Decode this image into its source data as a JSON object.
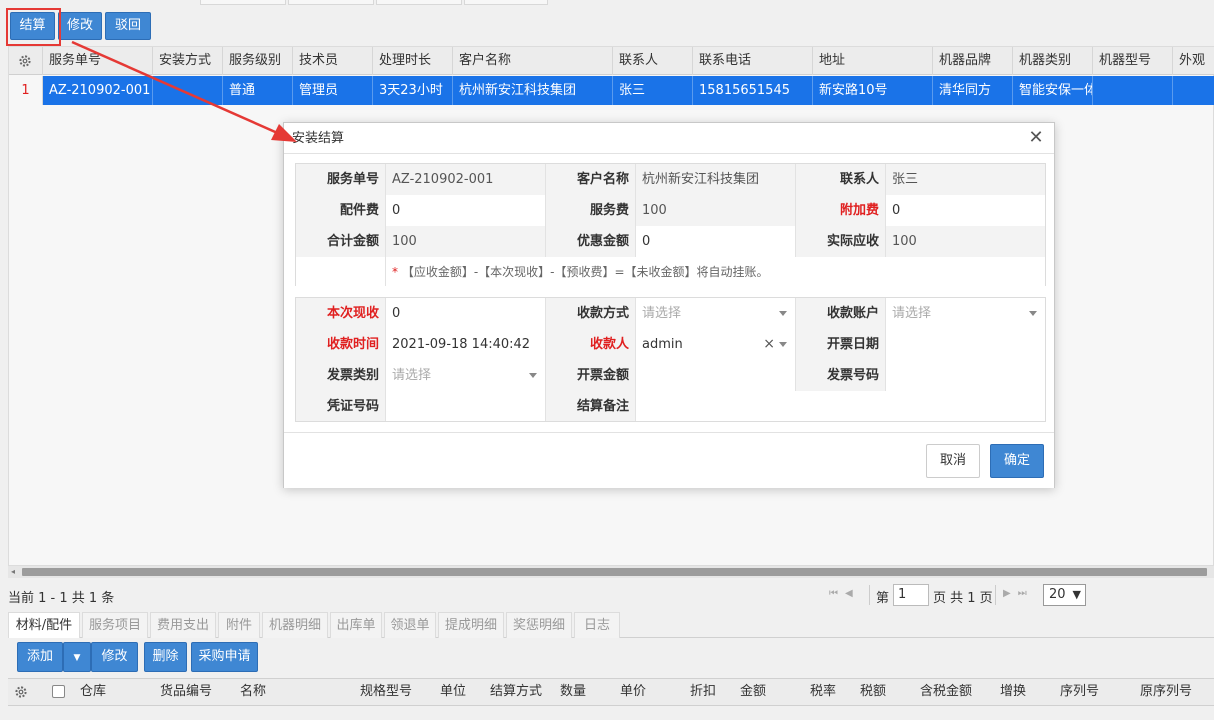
{
  "toolbar": {
    "settle_label": "结算",
    "modify_label": "修改",
    "reject_label": "驳回"
  },
  "grid": {
    "columns": [
      "服务单号",
      "安装方式",
      "服务级别",
      "技术员",
      "处理时长",
      "客户名称",
      "联系人",
      "联系电话",
      "地址",
      "机器品牌",
      "机器类别",
      "机器型号",
      "外观"
    ],
    "rows": [
      {
        "index": "1",
        "cells": [
          "AZ-210902-001",
          "",
          "普通",
          "管理员",
          "3天23小时",
          "杭州新安江科技集团",
          "张三",
          "15815651545",
          "新安路10号",
          "清华同方",
          "智能安保一体",
          "",
          ""
        ]
      }
    ]
  },
  "pager": {
    "summary": "当前 1 - 1 共 1 条",
    "page_prefix": "第",
    "page_value": "1",
    "page_suffix": "页 共 1 页",
    "page_size": "20"
  },
  "subtabs": [
    "材料/配件",
    "服务项目",
    "费用支出",
    "附件",
    "机器明细",
    "出库单",
    "领退单",
    "提成明细",
    "奖惩明细",
    "日志"
  ],
  "subbar": {
    "add_label": "添加",
    "modify_label": "修改",
    "delete_label": "删除",
    "purchase_label": "采购申请"
  },
  "material_columns": [
    "仓库",
    "货品编号",
    "名称",
    "规格型号",
    "单位",
    "结算方式",
    "数量",
    "单价",
    "折扣",
    "金额",
    "税率",
    "税额",
    "含税金额",
    "增换",
    "序列号",
    "原序列号"
  ],
  "dialog": {
    "title": "安装结算",
    "fields": {
      "service_no_label": "服务单号",
      "service_no": "AZ-210902-001",
      "customer_label": "客户名称",
      "customer": "杭州新安江科技集团",
      "contact_label": "联系人",
      "contact": "张三",
      "parts_fee_label": "配件费",
      "parts_fee": "0",
      "service_fee_label": "服务费",
      "service_fee": "100",
      "extra_fee_label": "附加费",
      "extra_fee": "0",
      "total_label": "合计金额",
      "total": "100",
      "discount_label": "优惠金额",
      "discount": "0",
      "actual_label": "实际应收",
      "actual": "100",
      "note_star": "*",
      "note": "【应收金额】-【本次现收】-【预收费】=【未收金额】将自动挂账。",
      "received_label": "本次现收",
      "received": "0",
      "pay_method_label": "收款方式",
      "pay_method_placeholder": "请选择",
      "account_label": "收款账户",
      "account_placeholder": "请选择",
      "received_time_label": "收款时间",
      "received_time": "2021-09-18 14:40:42",
      "payee_label": "收款人",
      "payee": "admin",
      "clear_mark": "×",
      "invoice_date_label": "开票日期",
      "invoice_type_label": "发票类别",
      "invoice_type_placeholder": "请选择",
      "invoice_amount_label": "开票金额",
      "invoice_no_label": "发票号码",
      "voucher_label": "凭证号码",
      "remark_label": "结算备注"
    },
    "cancel_label": "取消",
    "ok_label": "确定"
  },
  "colors": {
    "primary": "#3f87d3",
    "selected_row": "#1a73e8",
    "required": "#e02020",
    "annotation": "#e53935"
  }
}
